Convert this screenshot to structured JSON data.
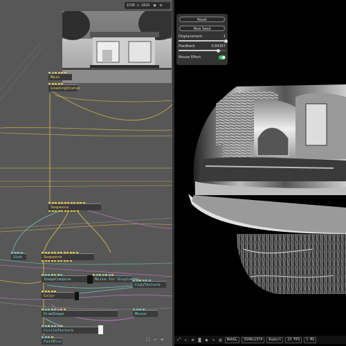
{
  "patch": {
    "resolution_label": "1536 x 1024",
    "ops": {
      "main": "Main",
      "loading_status": "LoadingStatus",
      "sequence_top": "Sequence",
      "sink": "Sink",
      "sequence_mid": "Sequence",
      "image_compose": "ImageCompose",
      "noise": "Noise for Displacem",
      "copy_texture": "CopyTexture",
      "color": "Color",
      "draw_image": "DrawImage",
      "mouse": "Mouse",
      "circle_texture": "CircleTexture",
      "fast_blur": "FastBlur"
    },
    "bottom_tools": {
      "fit_icon": "fit-icon",
      "minus": "−",
      "plus": "+"
    }
  },
  "panel": {
    "reset_label": "Reset",
    "new_seed_label": "New Seed",
    "displacement_label": "Displacement",
    "displacement_value": "1",
    "displacement_fraction": 1.0,
    "feedback_label": "Feedback",
    "feedback_value": "0.84357",
    "feedback_fraction": 0.84,
    "mouse_effect_label": "Mouse Effect",
    "mouse_effect_on": true
  },
  "status": {
    "webgl": "WebGL",
    "resolution": "3348x1374",
    "aspect": "Aspect",
    "fps": "23 FPS",
    "ms": "1 MS"
  },
  "colors": {
    "wire_yellow": "#e8c84a",
    "wire_teal": "#6fc7c0",
    "wire_pink": "#c77ad0",
    "toggle_on": "#3bc26b"
  }
}
